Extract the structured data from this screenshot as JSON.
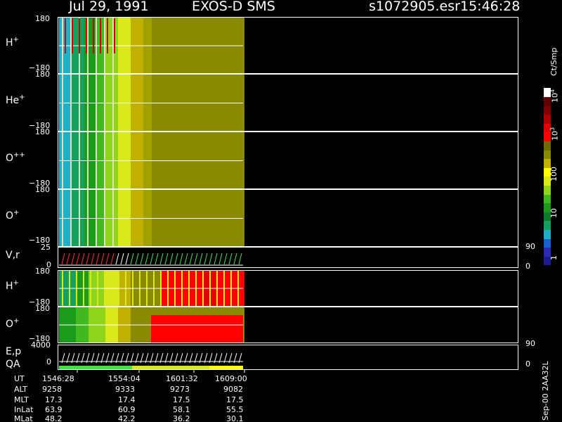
{
  "header": {
    "date": "Jul 29, 1991",
    "instrument": "EXOS-D SMS",
    "file": "s1072905.esr",
    "clock": "15:46:28"
  },
  "panels": [
    {
      "label": "H",
      "sup": "+",
      "ymax": "180",
      "ymin": "−180"
    },
    {
      "label": "He",
      "sup": "+",
      "ymax": "180",
      "ymin": "−180"
    },
    {
      "label": "O",
      "sup": "++",
      "ymax": "180",
      "ymin": "−180"
    },
    {
      "label": "O",
      "sup": "+",
      "ymax": "180",
      "ymin": "−180"
    },
    {
      "label": "V,r",
      "sup": "",
      "ymax": "25",
      "ymin": "0",
      "rmax": "90",
      "rmin": "0"
    },
    {
      "label": "H",
      "sup": "+",
      "ymax": "180",
      "ymin": "−180"
    },
    {
      "label": "O",
      "sup": "+",
      "ymax": "180",
      "ymin": "−180"
    },
    {
      "label": "E,p",
      "sup": "",
      "ymax": "4000",
      "ymin": "0",
      "rmax": "90",
      "rmin": "0"
    }
  ],
  "qa_label": "QA",
  "colorbar": {
    "unit": "Ct/Smp",
    "ticks": [
      "10",
      "10",
      "100",
      "10",
      "1"
    ],
    "exponents": [
      "4",
      "3",
      "",
      "",
      ""
    ],
    "colors": [
      "#1b1b8f",
      "#2a2ab5",
      "#1a5fd0",
      "#1fb0c8",
      "#15a060",
      "#0e7c2a",
      "#1b9a1b",
      "#40b820",
      "#8ed41c",
      "#d8e81a",
      "#ffff00",
      "#c0b000",
      "#8a8a00",
      "#6e6e00",
      "#ff0000",
      "#e00000",
      "#b00000",
      "#800000",
      "#600000",
      "#ffffff"
    ]
  },
  "footer": {
    "rows": [
      {
        "name": "UT",
        "values": [
          "1546:28",
          "1554:04",
          "1601:32",
          "1609:00"
        ]
      },
      {
        "name": "ALT",
        "values": [
          "9258",
          "9333",
          "9273",
          "9082"
        ]
      },
      {
        "name": "MLT",
        "values": [
          "17.3",
          "17.4",
          "17.5",
          "17.5"
        ]
      },
      {
        "name": "InLat",
        "values": [
          "63.9",
          "60.9",
          "58.1",
          "55.5"
        ]
      },
      {
        "name": "MLat",
        "values": [
          "48.2",
          "42.2",
          "36.2",
          "30.1"
        ]
      }
    ],
    "version": "Sep-00 2AA32L"
  }
}
